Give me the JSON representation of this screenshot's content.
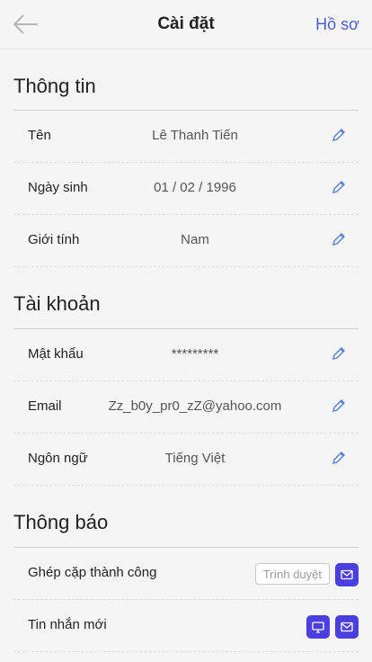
{
  "header": {
    "title": "Cài đặt",
    "profile_link": "Hồ sơ"
  },
  "sections": {
    "info": {
      "title": "Thông tin",
      "rows": [
        {
          "label": "Tên",
          "value": "Lê Thanh Tiến"
        },
        {
          "label": "Ngày sinh",
          "value": "01 / 02 / 1996"
        },
        {
          "label": "Giới tính",
          "value": "Nam"
        }
      ]
    },
    "account": {
      "title": "Tài khoản",
      "rows": [
        {
          "label": "Mật khẩu",
          "value": "*********"
        },
        {
          "label": "Email",
          "value": "Zz_b0y_pr0_zZ@yahoo.com"
        },
        {
          "label": "Ngôn ngữ",
          "value": "Tiếng Việt"
        }
      ]
    },
    "notify": {
      "title": "Thông báo",
      "rows": [
        {
          "label": "Ghép cặp thành công",
          "browser_option": "Trình duyệt"
        },
        {
          "label": "Tin nhắn mới"
        }
      ]
    }
  },
  "icons": {
    "back": "arrow-left-icon",
    "edit": "pencil-icon",
    "email": "envelope-icon",
    "desktop": "monitor-icon"
  },
  "colors": {
    "accent": "#4a3fe0",
    "link": "#4b5fd0",
    "edit_icon": "#5a7fcf"
  }
}
